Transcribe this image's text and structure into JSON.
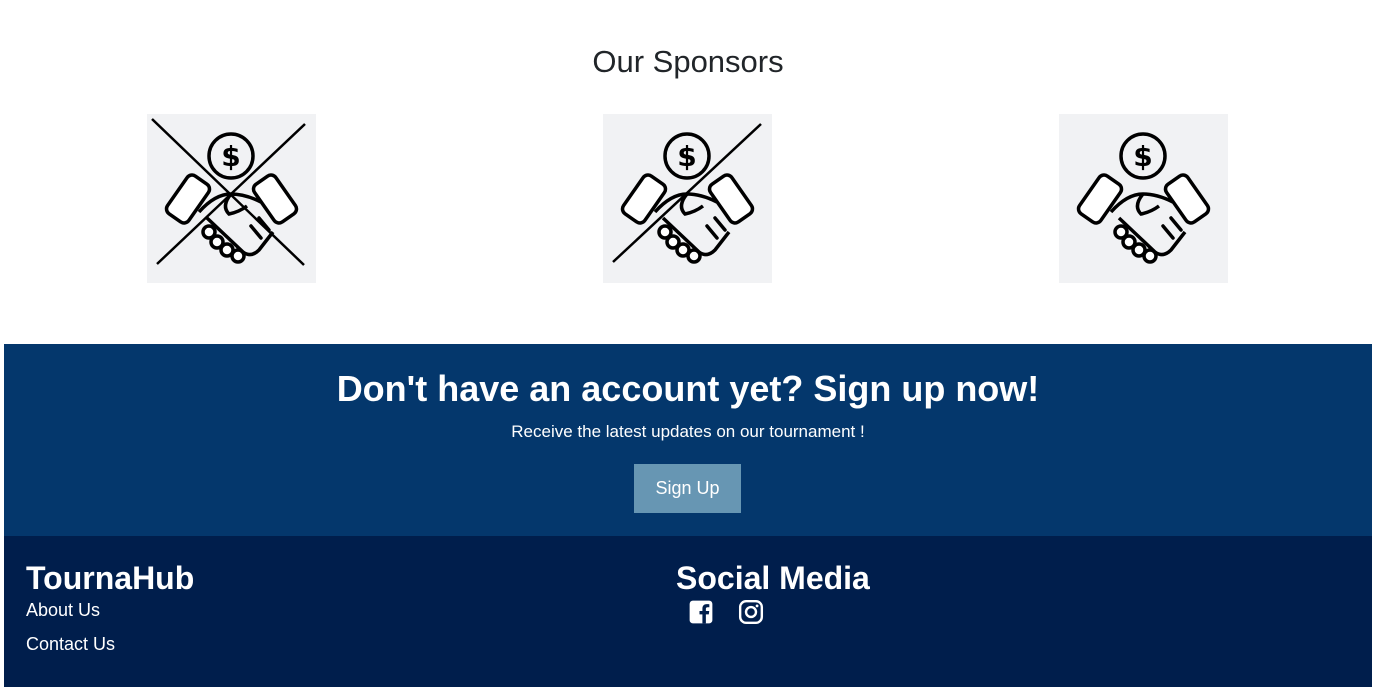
{
  "sponsors": {
    "title": "Our Sponsors",
    "logos": [
      {
        "icon": "sponsor-handshake-icon",
        "crossed": "double"
      },
      {
        "icon": "sponsor-handshake-icon",
        "crossed": "single"
      },
      {
        "icon": "sponsor-handshake-icon",
        "crossed": "none"
      }
    ]
  },
  "signup_banner": {
    "title": "Don't have an account yet? Sign up now!",
    "subtitle": "Receive the latest updates on our tournament !",
    "button_label": "Sign Up"
  },
  "footer": {
    "brand": "TournaHub",
    "links": [
      "About Us",
      "Contact Us"
    ],
    "social_title": "Social Media",
    "social_icons": [
      "facebook-icon",
      "instagram-icon"
    ]
  },
  "colors": {
    "banner_bg": "#04376c",
    "footer_bg": "#001e4c",
    "button_bg": "#6796b3",
    "logo_bg": "#f1f2f4"
  }
}
